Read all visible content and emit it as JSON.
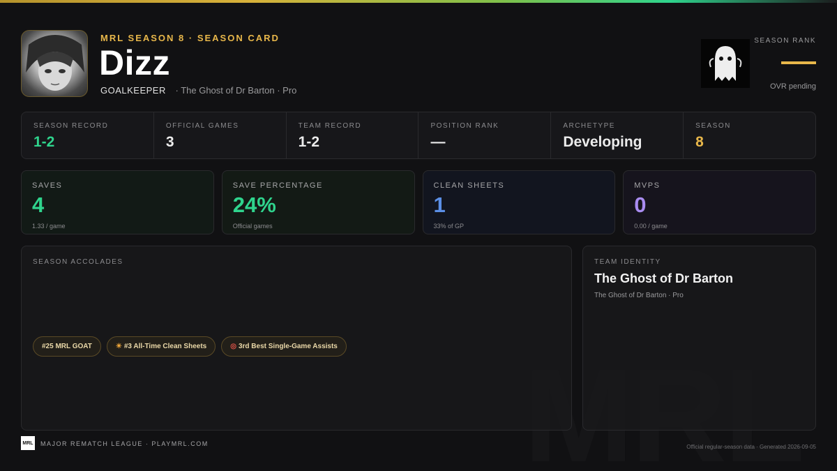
{
  "header": {
    "eyebrow": "MRL SEASON 8 · SEASON CARD",
    "player_name": "Dizz",
    "position": "GOALKEEPER",
    "team_tag": "· The Ghost of Dr Barton · Pro",
    "rank_label": "SEASON RANK",
    "rank_note": "OVR pending"
  },
  "summary": [
    {
      "label": "SEASON RECORD",
      "value": "1-2",
      "color": "#2fd48d"
    },
    {
      "label": "OFFICIAL GAMES",
      "value": "3",
      "color": "#ececec"
    },
    {
      "label": "TEAM RECORD",
      "value": "1-2",
      "color": "#ececec"
    },
    {
      "label": "POSITION RANK",
      "value": "—",
      "color": "#ececec"
    },
    {
      "label": "ARCHETYPE",
      "value": "Developing",
      "color": "#ececec"
    },
    {
      "label": "SEASON",
      "value": "8",
      "color": "#e8b74a"
    }
  ],
  "stats": [
    {
      "label": "SAVES",
      "value": "4",
      "sub": "1.33 / game",
      "color": "#2fd48d",
      "bg": "#121a16"
    },
    {
      "label": "SAVE PERCENTAGE",
      "value": "24%",
      "sub": "Official games",
      "color": "#2fd48d",
      "bg": "#131a15"
    },
    {
      "label": "CLEAN SHEETS",
      "value": "1",
      "sub": "33% of GP",
      "color": "#5b8fe6",
      "bg": "#12151f"
    },
    {
      "label": "MVPS",
      "value": "0",
      "sub": "0.00 / game",
      "color": "#a98cf0",
      "bg": "#16141d"
    }
  ],
  "accolades": {
    "label": "SEASON ACCOLADES",
    "badges": [
      {
        "glyph": "",
        "text": "#25 MRL GOAT"
      },
      {
        "glyph": "☀",
        "text": "#3 All-Time Clean Sheets"
      },
      {
        "glyph": "◎",
        "text": "3rd Best Single-Game Assists"
      }
    ]
  },
  "team_identity": {
    "label": "TEAM IDENTITY",
    "name": "The Ghost of Dr Barton",
    "sub": "The Ghost of Dr Barton · Pro"
  },
  "footer": {
    "logo_text": "MRL",
    "left": "MAJOR REMATCH LEAGUE · PLAYMRL.COM",
    "right": "Official regular-season data · Generated 2026-09-05",
    "watermark": "MRL"
  }
}
